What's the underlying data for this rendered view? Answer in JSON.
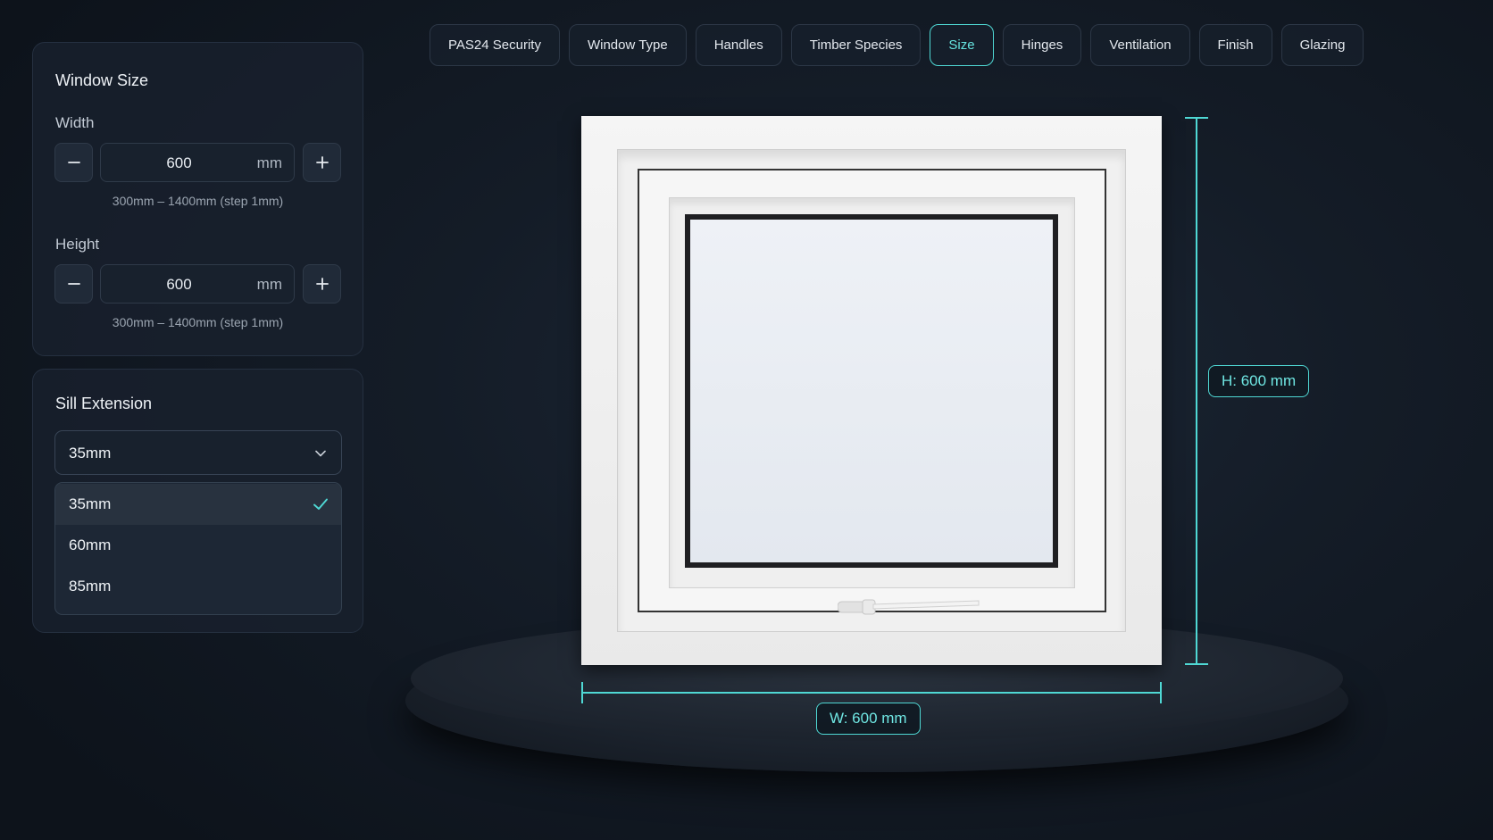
{
  "tabs": [
    {
      "label": "PAS24 Security",
      "active": false
    },
    {
      "label": "Window Type",
      "active": false
    },
    {
      "label": "Handles",
      "active": false
    },
    {
      "label": "Timber Species",
      "active": false
    },
    {
      "label": "Size",
      "active": true
    },
    {
      "label": "Hinges",
      "active": false
    },
    {
      "label": "Ventilation",
      "active": false
    },
    {
      "label": "Finish",
      "active": false
    },
    {
      "label": "Glazing",
      "active": false
    }
  ],
  "window_size": {
    "title": "Window Size",
    "width": {
      "label": "Width",
      "value": "600",
      "unit": "mm",
      "hint": "300mm – 1400mm (step 1mm)"
    },
    "height": {
      "label": "Height",
      "value": "600",
      "unit": "mm",
      "hint": "300mm – 1400mm (step 1mm)"
    }
  },
  "sill_extension": {
    "title": "Sill Extension",
    "selected": "35mm",
    "options": [
      "35mm",
      "60mm",
      "85mm"
    ]
  },
  "dimensions": {
    "height_label": "H: 600 mm",
    "width_label": "W: 600 mm"
  },
  "colors": {
    "accent": "#4fd8d4",
    "background": "#141c27",
    "panel": "#18202c"
  },
  "icons": {
    "decrement": "minus-icon",
    "increment": "plus-icon",
    "dropdown": "chevron-down-icon",
    "selected": "check-icon"
  }
}
